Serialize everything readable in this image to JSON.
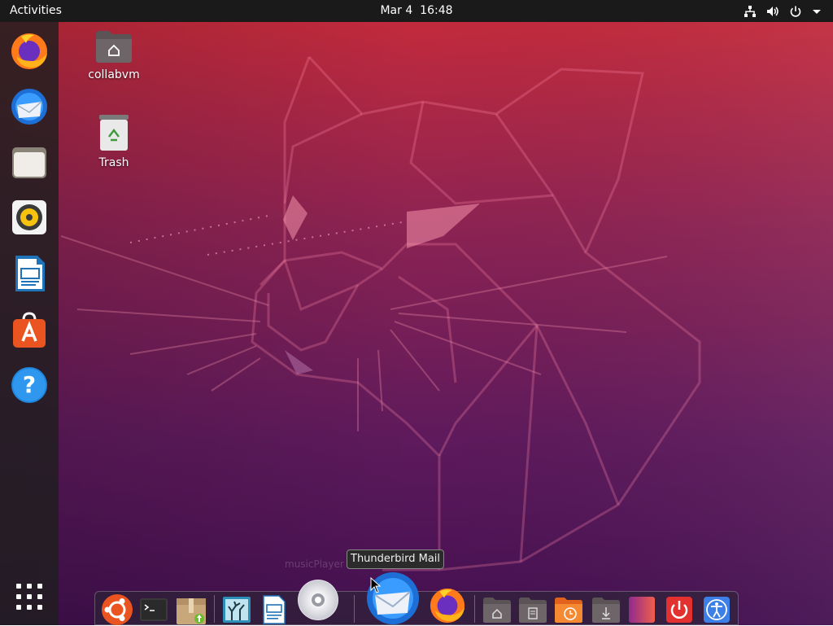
{
  "topbar": {
    "activities": "Activities",
    "date": "Mar 4",
    "time": "16:48",
    "tray_icons": [
      "network-icon",
      "volume-icon",
      "power-icon",
      "menu-arrow-icon"
    ]
  },
  "desktop": {
    "icons": [
      {
        "label": "collabvm",
        "icon": "home-folder-icon"
      },
      {
        "label": "Trash",
        "icon": "trash-icon"
      }
    ]
  },
  "side_dock": {
    "apps": [
      "Firefox",
      "Thunderbird Mail",
      "Files",
      "Rhythmbox",
      "LibreOffice Writer",
      "Ubuntu Software",
      "Help"
    ],
    "show_apps": "show-applications-icon"
  },
  "bottom_dock": {
    "ghost_label": "musicPlayer",
    "tooltip": "Thunderbird Mail",
    "items": [
      "ubuntu-icon",
      "terminal-icon",
      "archive-icon",
      "image-viewer-icon",
      "document-icon",
      "cd-icon",
      "thunderbird-icon",
      "firefox-icon",
      "home-folder-icon",
      "documents-folder-icon",
      "recent-folder-icon",
      "downloads-folder-icon",
      "gradient-app-icon",
      "power-icon",
      "accessibility-icon"
    ]
  },
  "colors": {
    "top_bar": "#1a1a1a",
    "wallpaper_top": "#c0283a",
    "wallpaper_bottom": "#4a1050",
    "accent": "#e95420"
  }
}
